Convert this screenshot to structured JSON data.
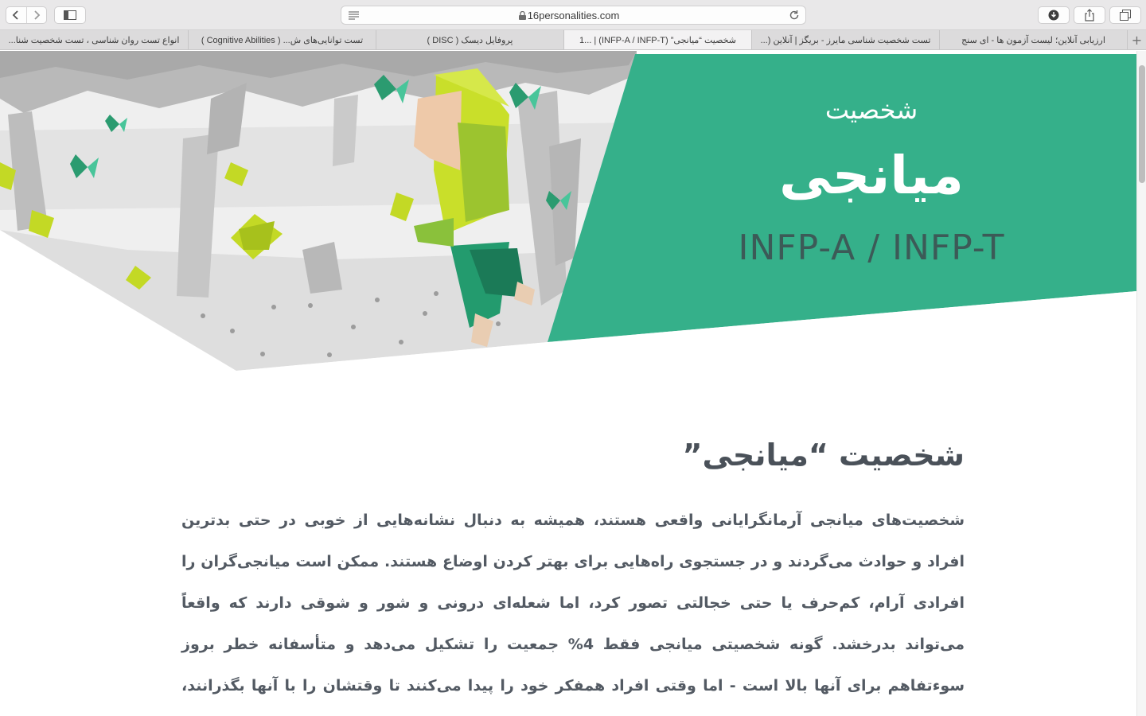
{
  "browser": {
    "url": "16personalities.com",
    "tabs": [
      {
        "label": "ارزیابی آنلاین؛ لیست آزمون ها - ای سنج",
        "active": false
      },
      {
        "label": "تست شخصیت شناسی مایرز - بریگز | آنلاین (...",
        "active": false
      },
      {
        "label": "شخصیت “میانجی” (INFP-A / INFP-T) | ...1",
        "active": true
      },
      {
        "label": "پروفایل دیسک ( DISC )",
        "active": false
      },
      {
        "label": "تست توانایی‌های ش... ( Cognitive Abilities )",
        "active": false
      },
      {
        "label": "انواع تست روان شناسی ، تست شخصیت شنا...",
        "active": false
      }
    ],
    "new_tab_label": "+"
  },
  "hero": {
    "subtitle": "شخصیت",
    "title": "میانجی",
    "code": "INFP-A / INFP-T",
    "accent_color": "#35b08a"
  },
  "article": {
    "title": "شخصیت “میانجی”",
    "body": "شخصیت‌های میانجی آرمانگرایانی واقعی هستند، همیشه به دنبال نشانه‌هایی از خوبی در حتی بدترین افراد و حوادث می‌گردند و در جستجوی راه‌هایی برای بهتر کردن اوضاع هستند. ممکن است میانجی‌گران را افرادی آرام، کم‌حرف یا حتی خجالتی تصور کرد، اما شعله‌ای درونی و شور و شوقی دارند که واقعاً می‌تواند بدرخشد. گونه شخصیتی میانجی فقط 4% جمعیت را تشکیل می‌دهد و متأسفانه خطر بروز سوءتفاهم برای آنها بالا است - اما وقتی افراد همفکر خود را پیدا می‌کنند تا وقتشان را با آنها بگذرانند، هماهنگی که احساس می‌کنند سرچشمه شادی و الهام‌بخشی است."
  }
}
